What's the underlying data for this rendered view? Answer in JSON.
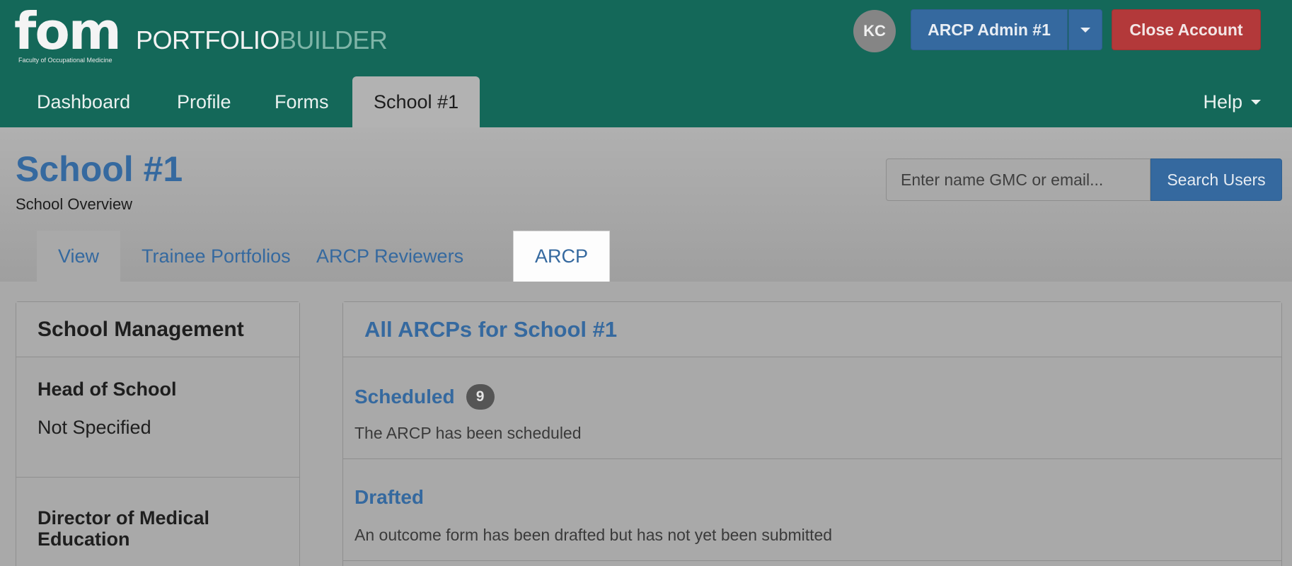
{
  "header": {
    "logo_text": "fom",
    "logo_subtitle": "Faculty of Occupational Medicine",
    "brand_part1": "PORTFOLIO",
    "brand_part2": "BUILDER",
    "avatar_initials": "KC",
    "user_button_label": "ARCP Admin #1",
    "close_account_label": "Close Account"
  },
  "main_nav": {
    "items": [
      {
        "label": "Dashboard"
      },
      {
        "label": "Profile"
      },
      {
        "label": "Forms"
      },
      {
        "label": "School #1",
        "active": true
      }
    ],
    "help_label": "Help"
  },
  "page": {
    "title": "School #1",
    "subtitle": "School Overview",
    "search_placeholder": "Enter name GMC or email...",
    "search_button": "Search Users"
  },
  "sub_tabs": [
    {
      "label": "View"
    },
    {
      "label": "Trainee Portfolios"
    },
    {
      "label": "ARCP Reviewers"
    },
    {
      "label": "ARCP",
      "active": true
    }
  ],
  "school_management": {
    "title": "School Management",
    "sections": [
      {
        "heading": "Head of School",
        "value": "Not Specified"
      },
      {
        "heading": "Director of Medical Education",
        "value": ""
      }
    ]
  },
  "arcps": {
    "title": "All ARCPs for School #1",
    "statuses": [
      {
        "name": "Scheduled",
        "count": "9",
        "description": "The ARCP has been scheduled"
      },
      {
        "name": "Drafted",
        "count": "",
        "description": "An outcome form has been drafted but has not yet been submitted"
      }
    ]
  },
  "colors": {
    "header_green": "#146859",
    "primary_blue": "#35699f",
    "danger_red": "#b3393a"
  }
}
